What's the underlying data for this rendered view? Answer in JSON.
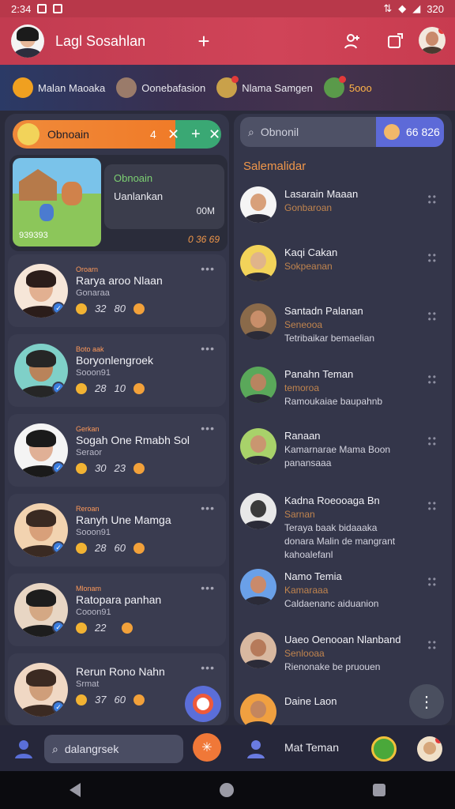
{
  "status": {
    "time": "2:34",
    "battery": "320"
  },
  "app": {
    "title": "Lagl Sosahlan",
    "accent": "#c23b50"
  },
  "stories": [
    {
      "label": "Malan Maoaka"
    },
    {
      "label": "Oonebafasion"
    },
    {
      "label": "Nlama Samgen"
    },
    {
      "label": "5ooo"
    }
  ],
  "left": {
    "tab": {
      "label": "Obnoain",
      "count": "4"
    },
    "featured": {
      "title": "Obnoain",
      "line1": "Uanlankan",
      "line2": "00M",
      "footer_left": "939393",
      "footer_right": "0 36 69"
    },
    "chats": [
      {
        "tag": "Oroarn",
        "name": "Rarya aroo Nlaan",
        "sub": "Gonaraa",
        "s1": "32",
        "s2": "80"
      },
      {
        "tag": "Boto aak",
        "name": "Boryonlengroek",
        "sub": "Sooon91",
        "s1": "28",
        "s2": "10"
      },
      {
        "tag": "Gerkan",
        "name": "Sogah One Rmabh Sol",
        "sub": "Seraor",
        "s1": "30",
        "s2": "23"
      },
      {
        "tag": "Reroan",
        "name": "Ranyh Une Mamga",
        "sub": "Sooon91",
        "s1": "28",
        "s2": "60"
      },
      {
        "tag": "Mlonam",
        "name": "Ratopara panhan",
        "sub": "Cooon91",
        "s1": "22",
        "s2": ""
      },
      {
        "tag": "",
        "name": "Rerun Rono Nahn",
        "sub": "Srmat",
        "s1": "37",
        "s2": "60"
      }
    ]
  },
  "right": {
    "search": {
      "placeholder": "Obnonil",
      "chip": "66 826"
    },
    "section": "Salemalidar",
    "contacts": [
      {
        "name": "Lasarain Maaan",
        "sub": "Gonbaroan",
        "msg": ""
      },
      {
        "name": "Kaqi Cakan",
        "sub": "Sokpeanan",
        "msg": ""
      },
      {
        "name": "Santadn Palanan",
        "sub": "Seneooa",
        "msg": "Tetribaikar bemaelian"
      },
      {
        "name": "Panahn Teman",
        "sub": "temoroa",
        "msg": "Ramoukaiae baupahnb"
      },
      {
        "name": "Ranaan",
        "sub": "",
        "msg": "Kamarnarae Mama Boon",
        "msg2": "panansaaa"
      },
      {
        "name": "Kadna Roeooaga Bn",
        "sub": "Sarnan",
        "msg": "Teraya baak bidaaaka",
        "msg2": "donara Malin de mangrant",
        "msg3": "kahoalefanl"
      },
      {
        "name": "Namo Temia",
        "sub": "Kamaraaa",
        "msg": "Caldaenanc aiduanion"
      },
      {
        "name": "Uaeo Oenooan Nlanband",
        "sub": "Senlooaa",
        "msg": "Rienonake be pruouen"
      },
      {
        "name": "Daine Laon",
        "sub": "",
        "msg": ""
      }
    ]
  },
  "bottom": {
    "search": "dalangrsek",
    "label": "Mat Teman"
  }
}
